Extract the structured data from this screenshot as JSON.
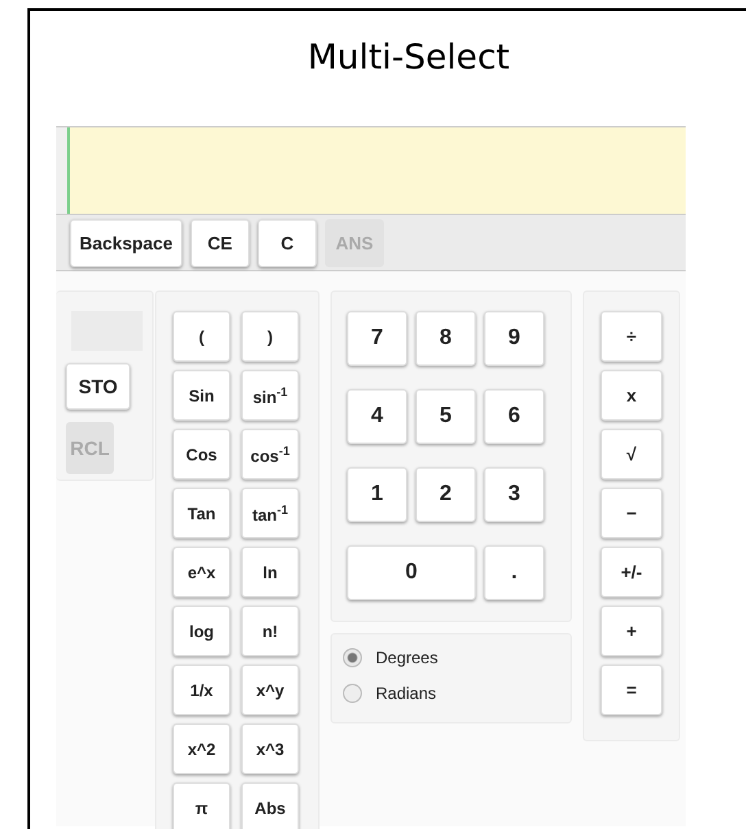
{
  "title": "Multi-Select",
  "edit_bar": [
    {
      "label": "Backspace",
      "disabled": false
    },
    {
      "label": "CE",
      "disabled": false
    },
    {
      "label": "C",
      "disabled": false
    },
    {
      "label": "ANS",
      "disabled": true
    }
  ],
  "memory": [
    {
      "label": "STO",
      "disabled": false
    },
    {
      "label": "RCL",
      "disabled": true
    }
  ],
  "functions": [
    {
      "label": "("
    },
    {
      "label": ")"
    },
    {
      "label": "Sin"
    },
    {
      "label": "sin$^{-1}$"
    },
    {
      "label": "Cos"
    },
    {
      "label": "cos$^{-1}$"
    },
    {
      "label": "Tan"
    },
    {
      "label": "tan$^{-1}$"
    },
    {
      "label": "e^x"
    },
    {
      "label": "ln"
    },
    {
      "label": "log"
    },
    {
      "label": "n!"
    },
    {
      "label": "1/x"
    },
    {
      "label": "x^y"
    },
    {
      "label": "x^2"
    },
    {
      "label": "x^3"
    },
    {
      "label": "π"
    },
    {
      "label": "Abs"
    }
  ],
  "numbers": [
    {
      "label": "7",
      "kind": "digit"
    },
    {
      "label": "8",
      "kind": "digit"
    },
    {
      "label": "9",
      "kind": "digit"
    },
    {
      "label": "4",
      "kind": "digit"
    },
    {
      "label": "5",
      "kind": "digit"
    },
    {
      "label": "6",
      "kind": "digit"
    },
    {
      "label": "1",
      "kind": "digit"
    },
    {
      "label": "2",
      "kind": "digit"
    },
    {
      "label": "3",
      "kind": "digit"
    },
    {
      "label": "0",
      "kind": "wide"
    },
    {
      "label": ".",
      "kind": "digit"
    }
  ],
  "angle_mode": [
    {
      "label": "Degrees",
      "selected": true
    },
    {
      "label": "Radians",
      "selected": false
    }
  ],
  "operators": [
    {
      "label": "÷"
    },
    {
      "label": "x"
    },
    {
      "label": "√"
    },
    {
      "label": "−"
    },
    {
      "label": "+/-"
    },
    {
      "label": "+"
    },
    {
      "label": "="
    }
  ]
}
